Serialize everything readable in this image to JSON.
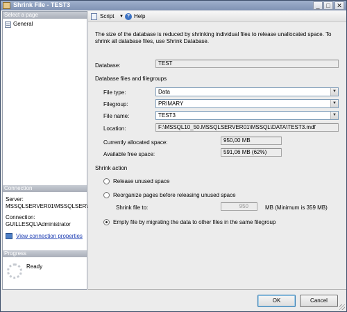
{
  "window": {
    "title": "Shrink File - TEST3"
  },
  "left": {
    "select_page": "Select a page",
    "pages": [
      {
        "label": "General"
      }
    ],
    "connection_header": "Connection",
    "server_label": "Server:",
    "server_value": "MSSQLSERVER01\\MSSQLSER\\",
    "connection_label": "Connection:",
    "connection_value": "GUILLESQL\\Administrator",
    "view_props": "View connection properties",
    "progress_header": "Progress",
    "progress_status": "Ready"
  },
  "toolbar": {
    "script_label": "Script",
    "help_label": "Help"
  },
  "main": {
    "description": "The size of the database is reduced by shrinking individual files to release unallocated space. To shrink all database files, use Shrink Database.",
    "database_label": "Database:",
    "database_value": "TEST",
    "files_group_label": "Database files and filegroups",
    "file_type_label": "File type:",
    "file_type_value": "Data",
    "filegroup_label": "Filegroup:",
    "filegroup_value": "PRIMARY",
    "file_name_label": "File name:",
    "file_name_value": "TEST3",
    "location_label": "Location:",
    "location_value": "F:\\MSSQL10_50.MSSQLSERVER01\\MSSQL\\DATA\\TEST3.mdf",
    "allocated_label": "Currently allocated space:",
    "allocated_value": "950,00 MB",
    "free_label": "Available free space:",
    "free_value": "591,06 MB (62%)",
    "shrink_action_label": "Shrink action",
    "opt_release": "Release unused space",
    "opt_reorganize": "Reorganize pages before releasing unused space",
    "shrink_to_label": "Shrink file to:",
    "shrink_to_value": "950",
    "shrink_to_unit": "MB (Minimum is 359 MB)",
    "opt_empty": "Empty file by migrating the data to other files in the same filegroup",
    "selected_option": "empty"
  },
  "buttons": {
    "ok": "OK",
    "cancel": "Cancel"
  }
}
